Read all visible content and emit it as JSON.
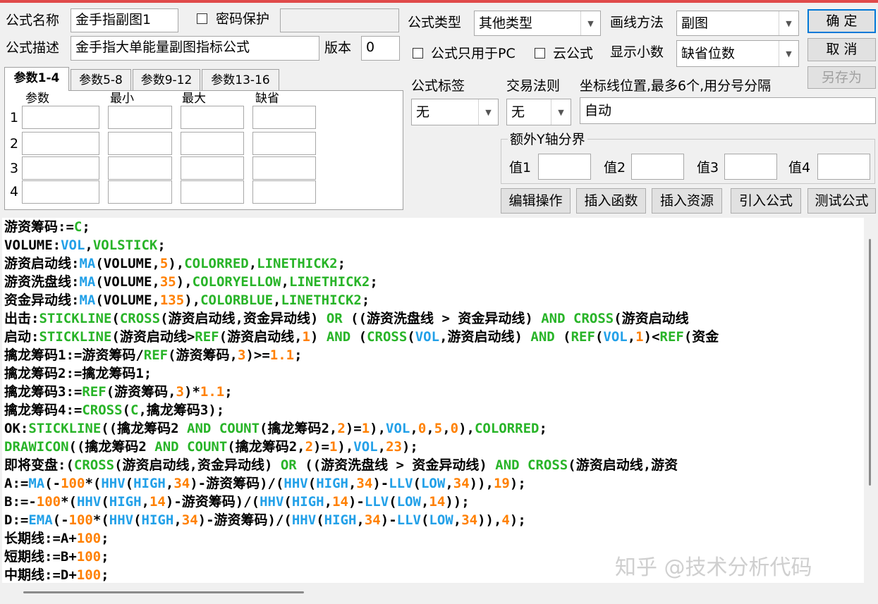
{
  "top": {
    "name_label": "公式名称",
    "name_value": "金手指副图1",
    "password_label": "密码保护",
    "desc_label": "公式描述",
    "desc_value": "金手指大单能量副图指标公式",
    "version_label": "版本",
    "version_value": "0",
    "type_label": "公式类型",
    "type_value": "其他类型",
    "draw_label": "画线方法",
    "draw_value": "副图",
    "pc_only_label": "公式只用于PC",
    "cloud_label": "云公式",
    "decimal_label": "显示小数",
    "decimal_value": "缺省位数"
  },
  "buttons": {
    "ok": "确  定",
    "cancel": "取  消",
    "save_as": "另存为",
    "edit_ops": "编辑操作",
    "insert_func": "插入函数",
    "insert_res": "插入资源",
    "import": "引入公式",
    "test": "测试公式"
  },
  "params": {
    "tabs": [
      "参数1-4",
      "参数5-8",
      "参数9-12",
      "参数13-16"
    ],
    "headers": [
      "参数",
      "最小",
      "最大",
      "缺省"
    ],
    "rows": [
      "1",
      "2",
      "3",
      "4"
    ]
  },
  "right": {
    "tag_label": "公式标签",
    "tag_value": "无",
    "rule_label": "交易法则",
    "rule_value": "无",
    "axis_label": "坐标线位置,最多6个,用分号分隔",
    "axis_value": "自动",
    "extra_y_label": "额外Y轴分界",
    "v1": "值1",
    "v2": "值2",
    "v3": "值3",
    "v4": "值4"
  },
  "watermark": "知乎 @技术分析代码",
  "code_lines": [
    [
      [
        "游资筹码:=",
        "c"
      ],
      [
        "C",
        "g"
      ],
      [
        ";",
        "c"
      ]
    ],
    [
      [
        "VOLUME:",
        "c"
      ],
      [
        "VOL",
        "f"
      ],
      [
        ",",
        "c"
      ],
      [
        "VOLSTICK",
        "g"
      ],
      [
        ";",
        "c"
      ]
    ],
    [
      [
        "游资启动线:",
        "c"
      ],
      [
        "MA",
        "f"
      ],
      [
        "(VOLUME,",
        "c"
      ],
      [
        "5",
        "n"
      ],
      [
        "),",
        "c"
      ],
      [
        "COLORRED",
        "g"
      ],
      [
        ",",
        "c"
      ],
      [
        "LINETHICK2",
        "g"
      ],
      [
        ";",
        "c"
      ]
    ],
    [
      [
        "游资洗盘线:",
        "c"
      ],
      [
        "MA",
        "f"
      ],
      [
        "(VOLUME,",
        "c"
      ],
      [
        "35",
        "n"
      ],
      [
        "),",
        "c"
      ],
      [
        "COLORYELLOW",
        "g"
      ],
      [
        ",",
        "c"
      ],
      [
        "LINETHICK2",
        "g"
      ],
      [
        ";",
        "c"
      ]
    ],
    [
      [
        "资金异动线:",
        "c"
      ],
      [
        "MA",
        "f"
      ],
      [
        "(VOLUME,",
        "c"
      ],
      [
        "135",
        "n"
      ],
      [
        "),",
        "c"
      ],
      [
        "COLORBLUE",
        "g"
      ],
      [
        ",",
        "c"
      ],
      [
        "LINETHICK2",
        "g"
      ],
      [
        ";",
        "c"
      ]
    ],
    [
      [
        "出击:",
        "c"
      ],
      [
        "STICKLINE",
        "g"
      ],
      [
        "(",
        "c"
      ],
      [
        "CROSS",
        "g"
      ],
      [
        "(游资启动线,资金异动线) ",
        "c"
      ],
      [
        "OR",
        "g"
      ],
      [
        " ((游资洗盘线 > 资金异动线) ",
        "c"
      ],
      [
        "AND",
        "g"
      ],
      [
        " ",
        "c"
      ],
      [
        "CROSS",
        "g"
      ],
      [
        "(游资启动线",
        "c"
      ]
    ],
    [
      [
        "启动:",
        "c"
      ],
      [
        "STICKLINE",
        "g"
      ],
      [
        "(游资启动线>",
        "c"
      ],
      [
        "REF",
        "g"
      ],
      [
        "(游资启动线,",
        "c"
      ],
      [
        "1",
        "n"
      ],
      [
        ") ",
        "c"
      ],
      [
        "AND",
        "g"
      ],
      [
        " (",
        "c"
      ],
      [
        "CROSS",
        "g"
      ],
      [
        "(",
        "c"
      ],
      [
        "VOL",
        "f"
      ],
      [
        ",游资启动线) ",
        "c"
      ],
      [
        "AND",
        "g"
      ],
      [
        " (",
        "c"
      ],
      [
        "REF",
        "g"
      ],
      [
        "(",
        "c"
      ],
      [
        "VOL",
        "f"
      ],
      [
        ",",
        "c"
      ],
      [
        "1",
        "n"
      ],
      [
        ")<",
        "c"
      ],
      [
        "REF",
        "g"
      ],
      [
        "(资金",
        "c"
      ]
    ],
    [
      [
        "擒龙筹码1:=游资筹码/",
        "c"
      ],
      [
        "REF",
        "g"
      ],
      [
        "(游资筹码,",
        "c"
      ],
      [
        "3",
        "n"
      ],
      [
        ")>=",
        "c"
      ],
      [
        "1.1",
        "n"
      ],
      [
        ";",
        "c"
      ]
    ],
    [
      [
        "擒龙筹码2:=擒龙筹码1;",
        "c"
      ]
    ],
    [
      [
        "擒龙筹码3:=",
        "c"
      ],
      [
        "REF",
        "g"
      ],
      [
        "(游资筹码,",
        "c"
      ],
      [
        "3",
        "n"
      ],
      [
        ")*",
        "c"
      ],
      [
        "1.1",
        "n"
      ],
      [
        ";",
        "c"
      ]
    ],
    [
      [
        "擒龙筹码4:=",
        "c"
      ],
      [
        "CROSS",
        "g"
      ],
      [
        "(",
        "c"
      ],
      [
        "C",
        "g"
      ],
      [
        ",擒龙筹码3);",
        "c"
      ]
    ],
    [
      [
        "OK:",
        "c"
      ],
      [
        "STICKLINE",
        "g"
      ],
      [
        "((擒龙筹码2 ",
        "c"
      ],
      [
        "AND",
        "g"
      ],
      [
        " ",
        "c"
      ],
      [
        "COUNT",
        "g"
      ],
      [
        "(擒龙筹码2,",
        "c"
      ],
      [
        "2",
        "n"
      ],
      [
        ")=",
        "c"
      ],
      [
        "1",
        "n"
      ],
      [
        "),",
        "c"
      ],
      [
        "VOL",
        "f"
      ],
      [
        ",",
        "c"
      ],
      [
        "0",
        "n"
      ],
      [
        ",",
        "c"
      ],
      [
        "5",
        "n"
      ],
      [
        ",",
        "c"
      ],
      [
        "0",
        "n"
      ],
      [
        "),",
        "c"
      ],
      [
        "COLORRED",
        "g"
      ],
      [
        ";",
        "c"
      ]
    ],
    [
      [
        "DRAWICON",
        "g"
      ],
      [
        "((擒龙筹码2 ",
        "c"
      ],
      [
        "AND",
        "g"
      ],
      [
        " ",
        "c"
      ],
      [
        "COUNT",
        "g"
      ],
      [
        "(擒龙筹码2,",
        "c"
      ],
      [
        "2",
        "n"
      ],
      [
        ")=",
        "c"
      ],
      [
        "1",
        "n"
      ],
      [
        "),",
        "c"
      ],
      [
        "VOL",
        "f"
      ],
      [
        ",",
        "c"
      ],
      [
        "23",
        "n"
      ],
      [
        ");",
        "c"
      ]
    ],
    [
      [
        "即将变盘:(",
        "c"
      ],
      [
        "CROSS",
        "g"
      ],
      [
        "(游资启动线,资金异动线) ",
        "c"
      ],
      [
        "OR",
        "g"
      ],
      [
        " ((游资洗盘线 > 资金异动线) ",
        "c"
      ],
      [
        "AND",
        "g"
      ],
      [
        " ",
        "c"
      ],
      [
        "CROSS",
        "g"
      ],
      [
        "(游资启动线,游资",
        "c"
      ]
    ],
    [
      [
        "A:=",
        "c"
      ],
      [
        "MA",
        "f"
      ],
      [
        "(-",
        "c"
      ],
      [
        "100",
        "n"
      ],
      [
        "*(",
        "c"
      ],
      [
        "HHV",
        "f"
      ],
      [
        "(",
        "c"
      ],
      [
        "HIGH",
        "f"
      ],
      [
        ",",
        "c"
      ],
      [
        "34",
        "n"
      ],
      [
        ")-游资筹码)/(",
        "c"
      ],
      [
        "HHV",
        "f"
      ],
      [
        "(",
        "c"
      ],
      [
        "HIGH",
        "f"
      ],
      [
        ",",
        "c"
      ],
      [
        "34",
        "n"
      ],
      [
        ")-",
        "c"
      ],
      [
        "LLV",
        "f"
      ],
      [
        "(",
        "c"
      ],
      [
        "LOW",
        "f"
      ],
      [
        ",",
        "c"
      ],
      [
        "34",
        "n"
      ],
      [
        ")),",
        "c"
      ],
      [
        "19",
        "n"
      ],
      [
        ");",
        "c"
      ]
    ],
    [
      [
        "B:=-",
        "c"
      ],
      [
        "100",
        "n"
      ],
      [
        "*(",
        "c"
      ],
      [
        "HHV",
        "f"
      ],
      [
        "(",
        "c"
      ],
      [
        "HIGH",
        "f"
      ],
      [
        ",",
        "c"
      ],
      [
        "14",
        "n"
      ],
      [
        ")-游资筹码)/(",
        "c"
      ],
      [
        "HHV",
        "f"
      ],
      [
        "(",
        "c"
      ],
      [
        "HIGH",
        "f"
      ],
      [
        ",",
        "c"
      ],
      [
        "14",
        "n"
      ],
      [
        ")-",
        "c"
      ],
      [
        "LLV",
        "f"
      ],
      [
        "(",
        "c"
      ],
      [
        "LOW",
        "f"
      ],
      [
        ",",
        "c"
      ],
      [
        "14",
        "n"
      ],
      [
        "));",
        "c"
      ]
    ],
    [
      [
        "D:=",
        "c"
      ],
      [
        "EMA",
        "f"
      ],
      [
        "(-",
        "c"
      ],
      [
        "100",
        "n"
      ],
      [
        "*(",
        "c"
      ],
      [
        "HHV",
        "f"
      ],
      [
        "(",
        "c"
      ],
      [
        "HIGH",
        "f"
      ],
      [
        ",",
        "c"
      ],
      [
        "34",
        "n"
      ],
      [
        ")-游资筹码)/(",
        "c"
      ],
      [
        "HHV",
        "f"
      ],
      [
        "(",
        "c"
      ],
      [
        "HIGH",
        "f"
      ],
      [
        ",",
        "c"
      ],
      [
        "34",
        "n"
      ],
      [
        ")-",
        "c"
      ],
      [
        "LLV",
        "f"
      ],
      [
        "(",
        "c"
      ],
      [
        "LOW",
        "f"
      ],
      [
        ",",
        "c"
      ],
      [
        "34",
        "n"
      ],
      [
        ")),",
        "c"
      ],
      [
        "4",
        "n"
      ],
      [
        ");",
        "c"
      ]
    ],
    [
      [
        "长期线:=A+",
        "c"
      ],
      [
        "100",
        "n"
      ],
      [
        ";",
        "c"
      ]
    ],
    [
      [
        "短期线:=B+",
        "c"
      ],
      [
        "100",
        "n"
      ],
      [
        ";",
        "c"
      ]
    ],
    [
      [
        "中期线:=D+",
        "c"
      ],
      [
        "100",
        "n"
      ],
      [
        ";",
        "c"
      ]
    ]
  ]
}
